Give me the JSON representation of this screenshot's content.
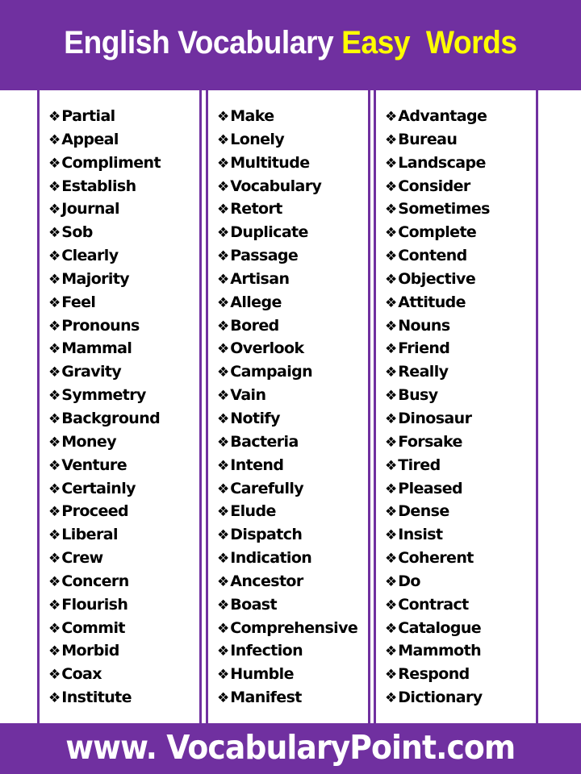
{
  "header": {
    "title_part1": "English Vocabulary",
    "title_part2": "Easy  Words",
    "colors": {
      "background": "#7030a0",
      "part1": "#ffffff",
      "part2": "#ffff00"
    }
  },
  "bullet_icon": "❖",
  "columns": [
    {
      "words": [
        "Partial",
        "Appeal",
        "Compliment",
        "Establish",
        "Journal",
        "Sob",
        "Clearly",
        "Majority",
        "Feel",
        "Pronouns",
        "Mammal",
        "Gravity",
        "Symmetry",
        "Background",
        "Money",
        "Venture",
        "Certainly",
        "Proceed",
        "Liberal",
        "Crew",
        "Concern",
        "Flourish",
        "Commit",
        "Morbid",
        "Coax",
        "Institute"
      ]
    },
    {
      "words": [
        "Make",
        "Lonely",
        "Multitude",
        "Vocabulary",
        "Retort",
        "Duplicate",
        "Passage",
        "Artisan",
        "Allege",
        "Bored",
        "Overlook",
        "Campaign",
        "Vain",
        "Notify",
        "Bacteria",
        "Intend",
        "Carefully",
        "Elude",
        "Dispatch",
        "Indication",
        "Ancestor",
        "Boast",
        "Comprehensive",
        "Infection",
        "Humble",
        "Manifest"
      ]
    },
    {
      "words": [
        "Advantage",
        "Bureau",
        "Landscape",
        "Consider",
        "Sometimes",
        "Complete",
        "Contend",
        "Objective",
        "Attitude",
        "Nouns",
        "Friend",
        "Really",
        "Busy",
        "Dinosaur",
        "Forsake",
        "Tired",
        "Pleased",
        "Dense",
        "Insist",
        "Coherent",
        "Do",
        "Contract",
        "Catalogue",
        "Mammoth",
        "Respond",
        "Dictionary"
      ]
    }
  ],
  "footer": {
    "url": "www. VocabularyPoint.com"
  }
}
